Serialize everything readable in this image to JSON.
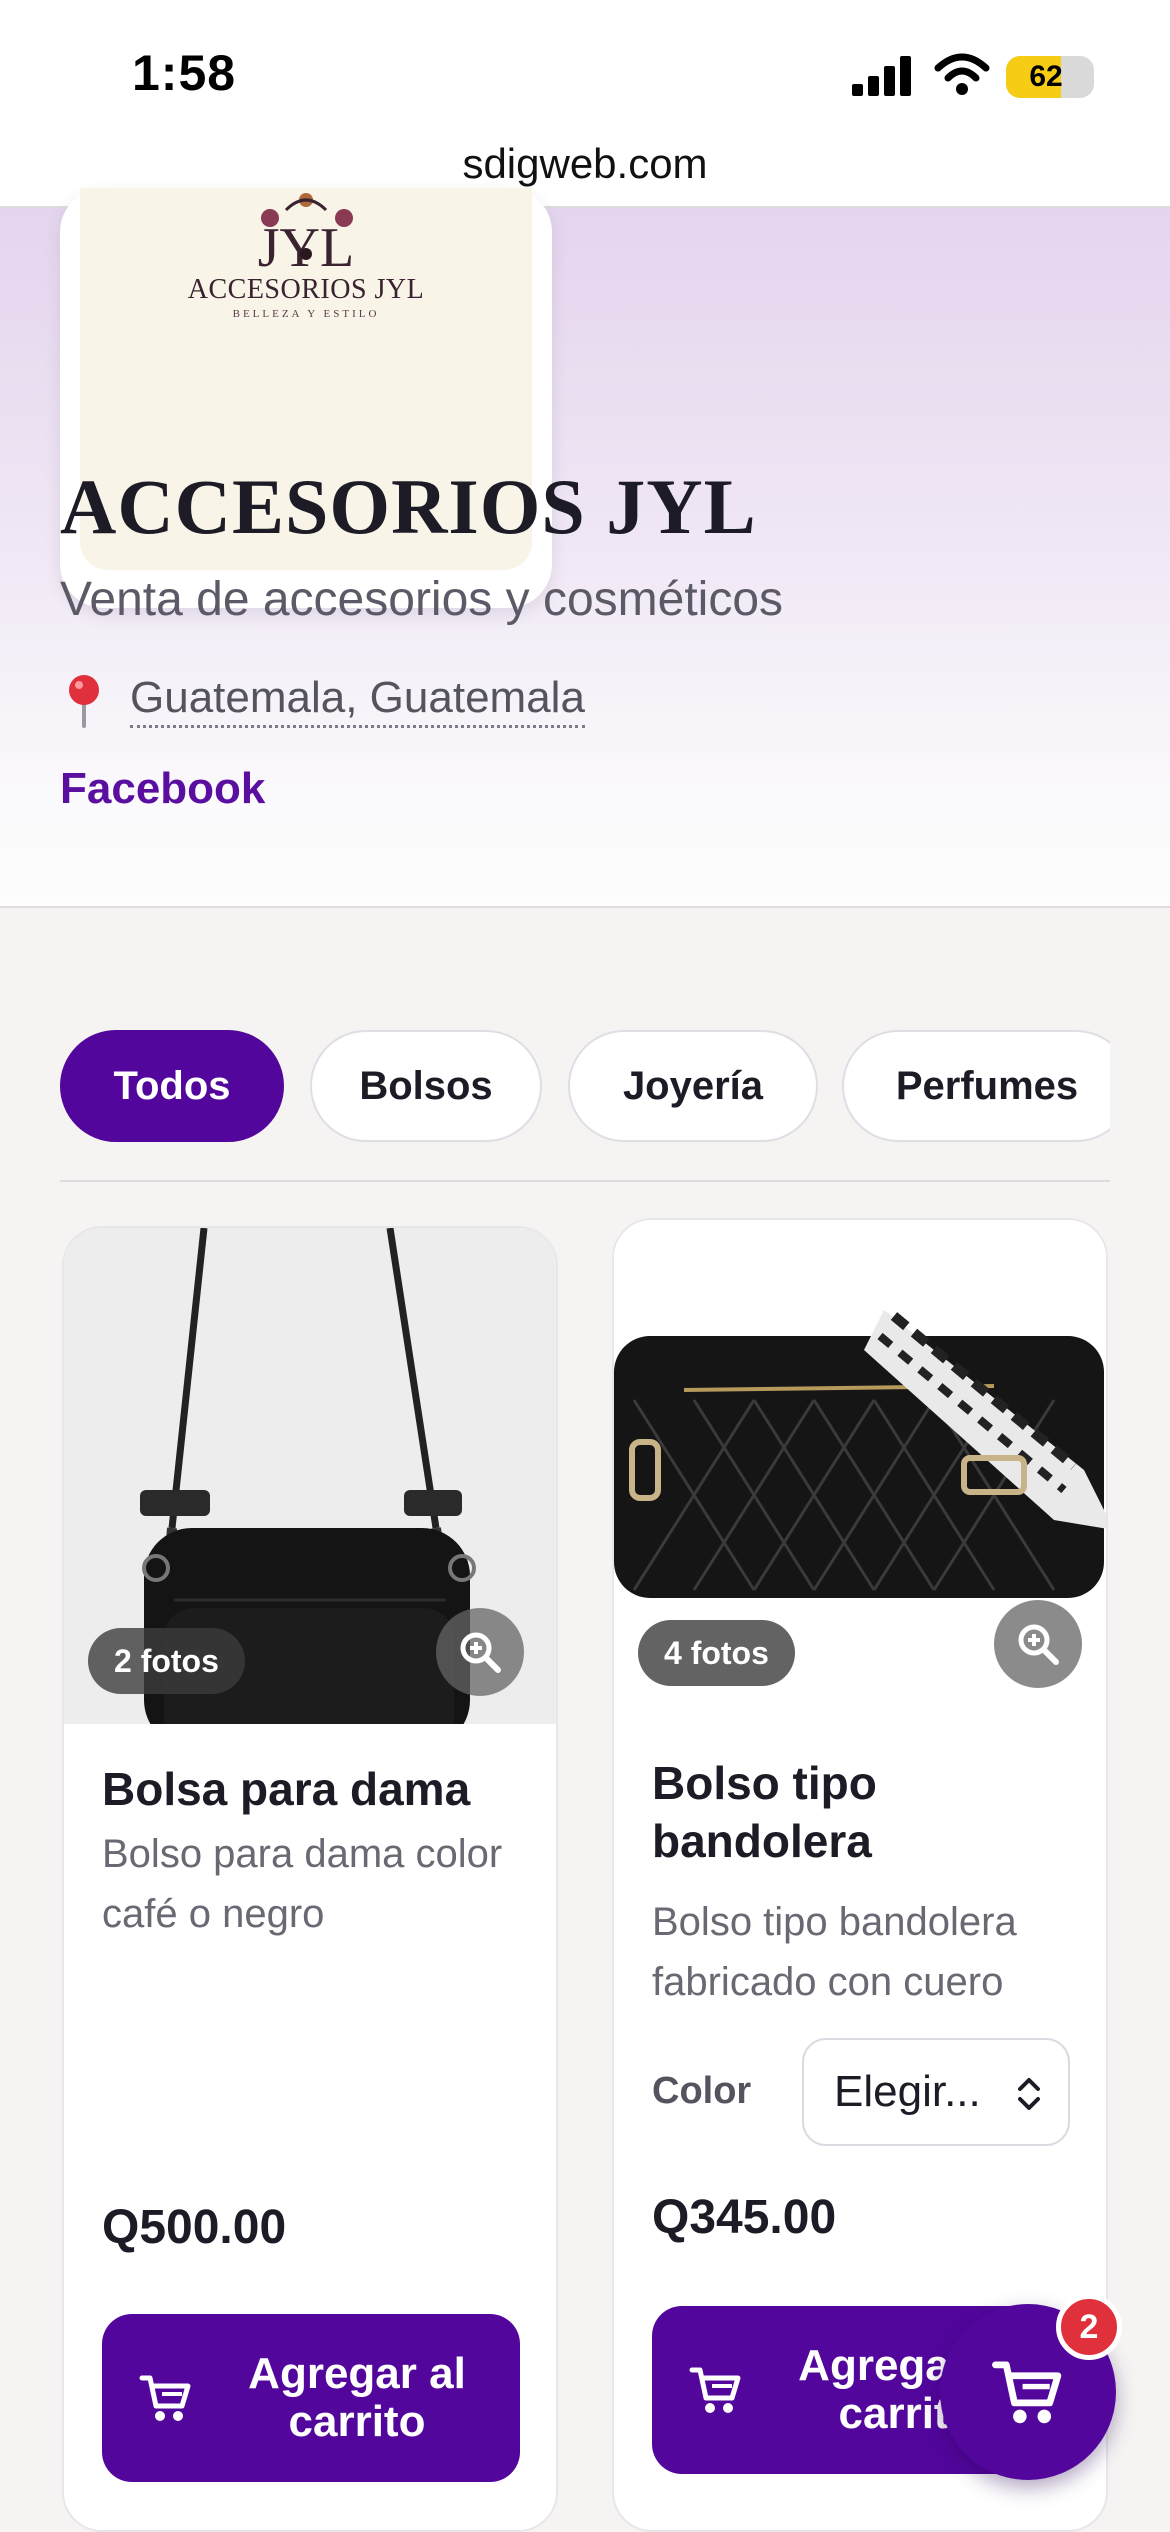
{
  "status_bar": {
    "time": "1:58",
    "battery": "62",
    "battery_level": 0.62
  },
  "browser": {
    "url": "sdigweb.com"
  },
  "store": {
    "logo_name": "ACCESORIOS JYL",
    "logo_tagline": "BELLEZA Y ESTILO",
    "name": "ACCESORIOS JYL",
    "description": "Venta de accesorios y cosméticos",
    "location": "Guatemala, Guatemala",
    "social_link": "Facebook"
  },
  "categories": {
    "tabs": [
      {
        "label": "Todos",
        "active": true
      },
      {
        "label": "Bolsos",
        "active": false
      },
      {
        "label": "Joyería",
        "active": false
      },
      {
        "label": "Perfumes",
        "active": false
      }
    ]
  },
  "products": [
    {
      "photos_badge": "2 fotos",
      "name": "Bolsa para dama",
      "description": "Bolso para dama color café o negro",
      "price": "Q500.00",
      "add_button": "Agregar al carrito"
    },
    {
      "photos_badge": "4 fotos",
      "name": "Bolso tipo bandolera",
      "description": "Bolso tipo bandolera fabricado con cuero",
      "option_label": "Color",
      "option_value": "Elegir...",
      "price": "Q345.00",
      "add_button": "Agregar al carrito"
    }
  ],
  "cart": {
    "count": "2"
  },
  "colors": {
    "brand": "#52069c",
    "badge": "#e0303c",
    "battery": "#f6cd14"
  },
  "icons": [
    "signal-icon",
    "wifi-icon",
    "battery-icon",
    "location-pin-icon",
    "zoom-icon",
    "cart-icon"
  ]
}
